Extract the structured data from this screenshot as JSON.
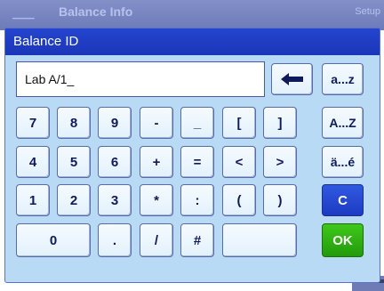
{
  "background": {
    "title": "Balance Info",
    "setup_label": "Setup"
  },
  "dialog": {
    "title": "Balance ID",
    "input_value": "Lab A/1_"
  },
  "keypad": {
    "row1": [
      "7",
      "8",
      "9",
      "-",
      "_",
      "[",
      "]"
    ],
    "row2": [
      "4",
      "5",
      "6",
      "+",
      "=",
      "<",
      ">"
    ],
    "row3": [
      "1",
      "2",
      "3",
      "*",
      ":",
      "(",
      ")"
    ],
    "row4": [
      "0",
      ".",
      "/",
      "#",
      ""
    ]
  },
  "side_keys": {
    "backspace_icon": "backspace-arrow-icon",
    "lowercase": "a...z",
    "uppercase": "A...Z",
    "accented": "ä...é",
    "clear": "C",
    "ok": "OK"
  },
  "colors": {
    "title_bar": "#1c36b8",
    "dialog_bg": "#b9daf4",
    "clear_key": "#2f59e0",
    "ok_key": "#2fb214"
  }
}
